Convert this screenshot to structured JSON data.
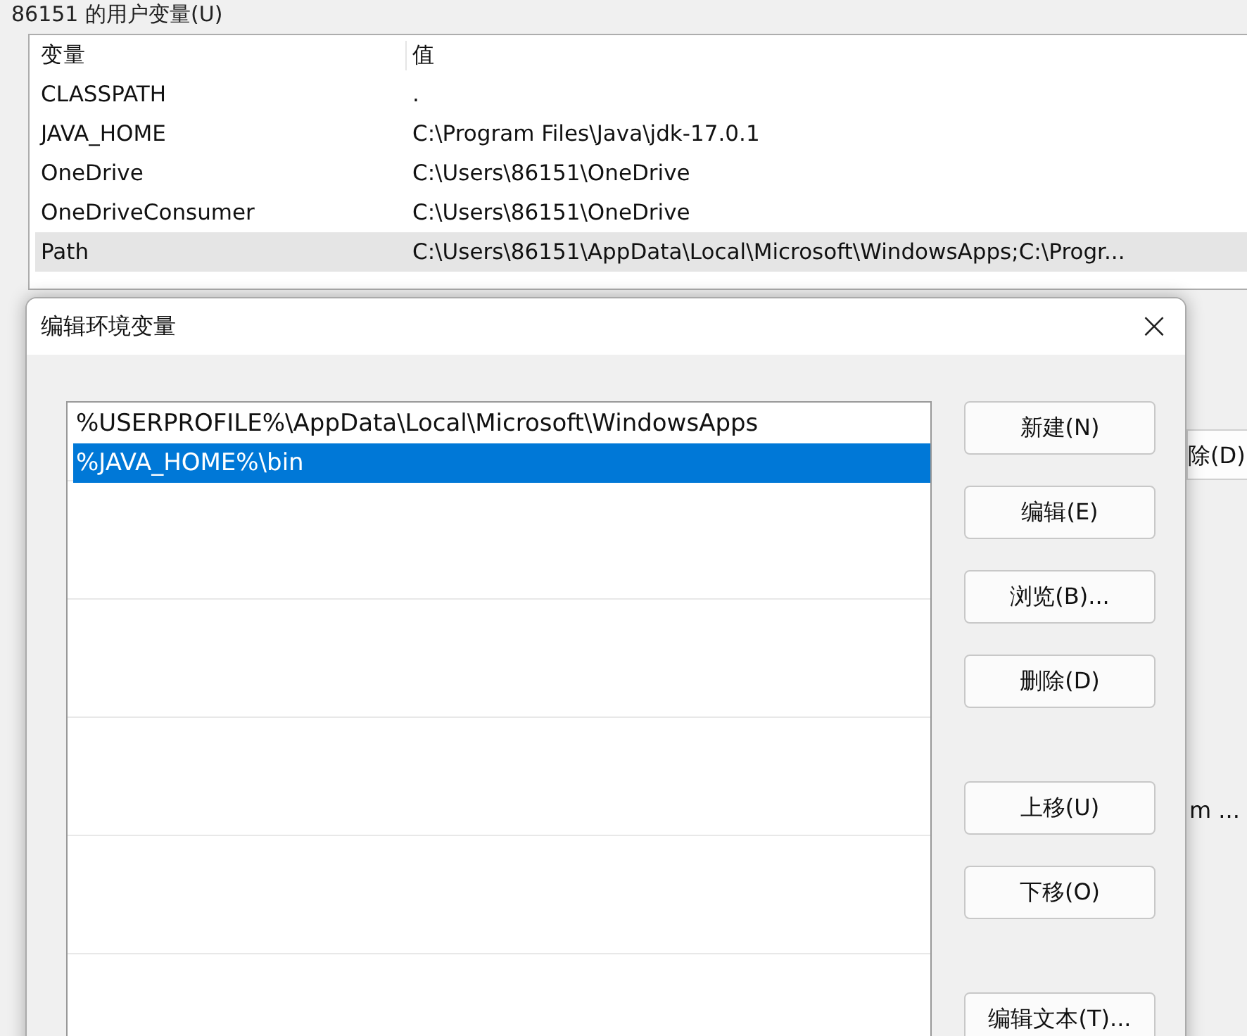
{
  "background_window": {
    "group_title": "86151 的用户变量(U)",
    "table": {
      "columns": [
        "变量",
        "值"
      ],
      "rows": [
        {
          "cells": [
            "CLASSPATH",
            "."
          ],
          "selected": false
        },
        {
          "cells": [
            "JAVA_HOME",
            "C:\\Program Files\\Java\\jdk-17.0.1"
          ],
          "selected": false
        },
        {
          "cells": [
            "OneDrive",
            "C:\\Users\\86151\\OneDrive"
          ],
          "selected": false
        },
        {
          "cells": [
            "OneDriveConsumer",
            "C:\\Users\\86151\\OneDrive"
          ],
          "selected": false
        },
        {
          "cells": [
            "Path",
            "C:\\Users\\86151\\AppData\\Local\\Microsoft\\WindowsApps;C:\\Progr..."
          ],
          "selected": true
        }
      ]
    },
    "delete_button": "除(D)",
    "value_fragment": "m ..."
  },
  "dialog": {
    "title": "编辑环境变量",
    "close": "×",
    "entries": [
      {
        "text": "%USERPROFILE%\\AppData\\Local\\Microsoft\\WindowsApps",
        "selected": false
      },
      {
        "text": "%JAVA_HOME%\\bin",
        "selected": true
      }
    ],
    "button_groups": [
      [
        "新建(N)",
        "编辑(E)",
        "浏览(B)...",
        "删除(D)"
      ],
      [
        "上移(U)",
        "下移(O)"
      ],
      [
        "编辑文本(T)..."
      ]
    ]
  }
}
